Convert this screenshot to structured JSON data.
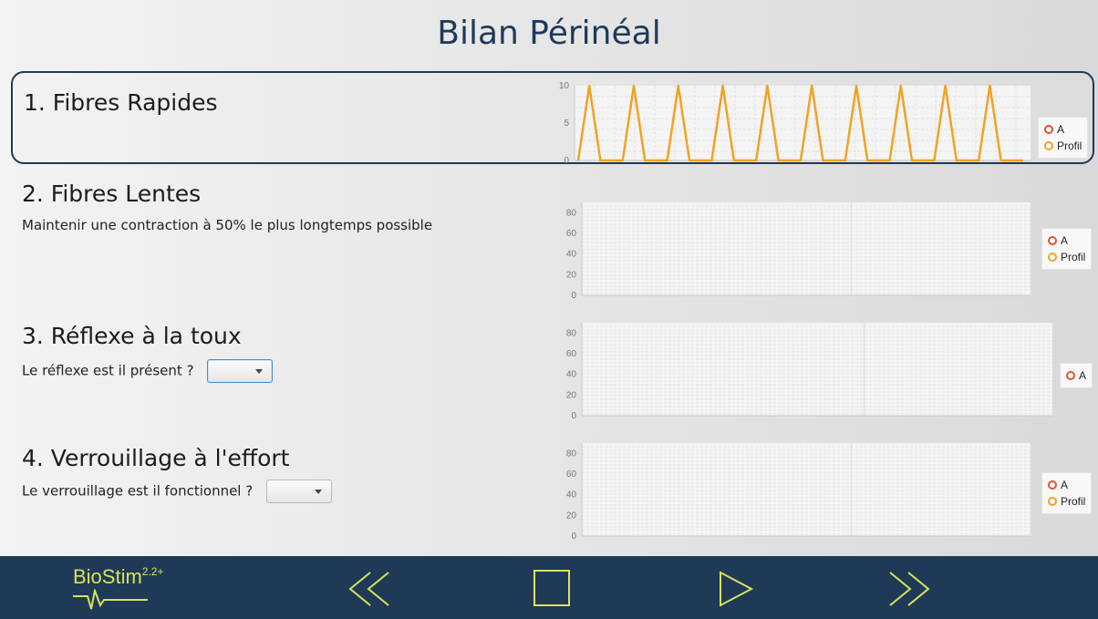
{
  "header": {
    "title": "Bilan Périnéal"
  },
  "sections": [
    {
      "title": "1. Fibres Rapides",
      "description": "",
      "legend": [
        {
          "label": "A",
          "color": "#e0532b"
        },
        {
          "label": "Profil",
          "color": "#f0a321"
        }
      ]
    },
    {
      "title": "2. Fibres Lentes",
      "description": "Maintenir une contraction à 50% le plus longtemps possible",
      "legend": [
        {
          "label": "A",
          "color": "#e0532b"
        },
        {
          "label": "Profil",
          "color": "#f0a321"
        }
      ]
    },
    {
      "title": "3. Réflexe à la toux",
      "description": "Le réflexe est il présent ?",
      "select_value": "",
      "legend": [
        {
          "label": "A",
          "color": "#e0532b"
        }
      ]
    },
    {
      "title": "4. Verrouillage à l'effort",
      "description": "Le verrouillage est il fonctionnel ?",
      "select_value": "",
      "legend": [
        {
          "label": "A",
          "color": "#e0532b"
        },
        {
          "label": "Profil",
          "color": "#f0a321"
        }
      ]
    }
  ],
  "chart_data": [
    {
      "type": "line",
      "ylim": [
        0,
        10
      ],
      "yticks": [
        "0",
        "5",
        "10"
      ],
      "series": [
        {
          "name": "Profil",
          "color": "#f0a321",
          "x": [
            0,
            1,
            2,
            3,
            4,
            5,
            6,
            7,
            8,
            9,
            10,
            11,
            12,
            13,
            14,
            15,
            16,
            17,
            18,
            19,
            20,
            21,
            22,
            23,
            24,
            25,
            26,
            27,
            28,
            29,
            30,
            31,
            32,
            33,
            34,
            35,
            36,
            37,
            38,
            39,
            40
          ],
          "y": [
            0,
            10,
            0,
            0,
            0,
            10,
            0,
            0,
            0,
            10,
            0,
            0,
            0,
            10,
            0,
            0,
            0,
            10,
            0,
            0,
            0,
            10,
            0,
            0,
            0,
            10,
            0,
            0,
            0,
            10,
            0,
            0,
            0,
            10,
            0,
            0,
            0,
            10,
            0,
            0,
            0
          ]
        }
      ]
    },
    {
      "type": "line",
      "ylim": [
        0,
        90
      ],
      "yticks": [
        "0",
        "20",
        "40",
        "60",
        "80"
      ],
      "series": []
    },
    {
      "type": "line",
      "ylim": [
        0,
        90
      ],
      "yticks": [
        "0",
        "20",
        "40",
        "60",
        "80"
      ],
      "series": []
    },
    {
      "type": "line",
      "ylim": [
        0,
        90
      ],
      "yticks": [
        "0",
        "20",
        "40",
        "60",
        "80"
      ],
      "series": []
    }
  ],
  "footer": {
    "logo_text": "BioStim",
    "logo_version": "2.2+",
    "accent_color": "#d9e25a",
    "controls": [
      {
        "name": "rewind-icon"
      },
      {
        "name": "stop-icon"
      },
      {
        "name": "play-icon"
      },
      {
        "name": "fast-forward-icon"
      }
    ]
  }
}
